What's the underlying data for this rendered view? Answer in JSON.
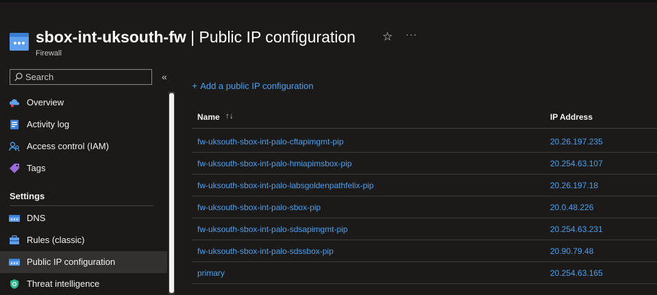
{
  "header": {
    "resource_name": "sbox-int-uksouth-fw",
    "separator": " | ",
    "page_name": "Public IP configuration",
    "subtitle": "Firewall",
    "icon": "firewall-icon",
    "star_icon": "☆",
    "more_icon": "···"
  },
  "sidebar": {
    "search_placeholder": "Search",
    "collapse_icon": "«",
    "items": [
      {
        "label": "Overview",
        "icon": "overview-icon"
      },
      {
        "label": "Activity log",
        "icon": "activity-log-icon"
      },
      {
        "label": "Access control (IAM)",
        "icon": "iam-icon"
      },
      {
        "label": "Tags",
        "icon": "tag-icon"
      }
    ],
    "settings_heading": "Settings",
    "settings_items": [
      {
        "label": "DNS",
        "icon": "dns-icon"
      },
      {
        "label": "Rules (classic)",
        "icon": "rules-icon"
      },
      {
        "label": "Public IP configuration",
        "icon": "public-ip-icon",
        "selected": true
      },
      {
        "label": "Threat intelligence",
        "icon": "threat-intel-icon"
      }
    ]
  },
  "main": {
    "add_label": "Add a public IP configuration",
    "add_icon": "+",
    "columns": [
      "Name",
      "IP Address"
    ],
    "sort_icon": "↑↓",
    "rows": [
      {
        "name": "fw-uksouth-sbox-int-palo-cftapimgmt-pip",
        "ip": "20.26.197.235"
      },
      {
        "name": "fw-uksouth-sbox-int-palo-hmiapimsbox-pip",
        "ip": "20.254.63.107"
      },
      {
        "name": "fw-uksouth-sbox-int-palo-labsgoldenpathfelix-pip",
        "ip": "20.26.197.18"
      },
      {
        "name": "fw-uksouth-sbox-int-palo-sbox-pip",
        "ip": "20.0.48.226"
      },
      {
        "name": "fw-uksouth-sbox-int-palo-sdsapimgmt-pip",
        "ip": "20.254.63.231"
      },
      {
        "name": "fw-uksouth-sbox-int-palo-sdssbox-pip",
        "ip": "20.90.79.48"
      },
      {
        "name": "primary",
        "ip": "20.254.63.165"
      }
    ]
  },
  "colors": {
    "background": "#1b1a19",
    "link": "#4ba0f0",
    "selected": "#323130"
  }
}
